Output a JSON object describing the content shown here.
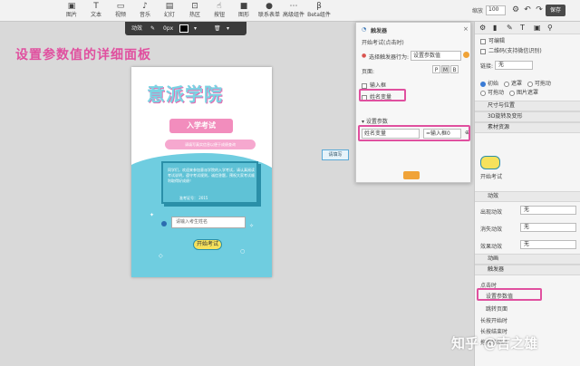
{
  "toolbar": {
    "items": [
      {
        "icon": "image-icon",
        "label": "图片"
      },
      {
        "icon": "text-icon",
        "label": "文本"
      },
      {
        "icon": "video-icon",
        "label": "视频"
      },
      {
        "icon": "music-icon",
        "label": "音乐"
      },
      {
        "icon": "slideshow-icon",
        "label": "幻灯"
      },
      {
        "icon": "hotspot-icon",
        "label": "热区"
      },
      {
        "icon": "button-icon",
        "label": "按钮"
      },
      {
        "icon": "shape-icon",
        "label": "图形"
      },
      {
        "icon": "contact-icon",
        "label": "联系表单"
      },
      {
        "icon": "advanced-icon",
        "label": "高级组件"
      },
      {
        "icon": "beta-icon",
        "label": "Beta组件"
      }
    ],
    "zoom_label": "缩放",
    "zoom_value": "100",
    "save_label": "保存"
  },
  "format_bar": {
    "animation": "动效",
    "stroke": "0px"
  },
  "heading": "设置参数值的详细面板",
  "poster": {
    "title": "意派学院",
    "subtitle": "入学考试",
    "tagline": "请填写真实信息以便于成绩查询",
    "card_text": "同学们，欢迎来参加意派学院的入学考试，请认真阅读考试说明，遵守考试规则，诚信答题，预祝大家考试顺利取得好成绩！",
    "card_code": "准考证号： 2015",
    "input_placeholder": "请输入考生姓名",
    "start_label": "开始考试"
  },
  "hint_bubble": "请填写",
  "trigger_panel": {
    "title": "触发器",
    "event_label": "开始考试(点击时)",
    "action_label": "选择触发器行为:",
    "action_value": "设置参数值",
    "page_label": "页面:",
    "page_options": [
      "P",
      "M",
      "B"
    ],
    "checkbox_input": "输入框",
    "checkbox_var": "姓名变量",
    "param_section": "设置参数",
    "param_var": "姓名变量",
    "param_value": "=输入框0"
  },
  "right_panel": {
    "checkbox_editable": "可编辑",
    "checkbox_qr": "二维码(支持微信识别)",
    "link_label": "链接:",
    "link_value": "无",
    "radios": [
      {
        "label": "初始",
        "on": true
      },
      {
        "label": "遮罩",
        "on": false
      },
      {
        "label": "可拖动",
        "on": false
      },
      {
        "label": "可拖动",
        "on": false
      },
      {
        "label": "图片遮罩",
        "on": false
      }
    ],
    "sec_size": "尺寸与位置",
    "sec_3d": "3D旋转及变形",
    "sec_assets": "素材资源",
    "asset_name": "开始考试",
    "sec_animation": "动效",
    "enter_label": "出现动效",
    "enter_value": "无",
    "exit_label": "消失动效",
    "exit_value": "无",
    "effect_label": "效果动效",
    "effect_value": "无",
    "sec_anim2": "动画",
    "sec_trigger": "触发器",
    "trigger_event": "点击时",
    "trigger_action": "设置参数值",
    "trigger_jump": "跳转页面",
    "trigger_longpress": "长按开始时",
    "trigger_longpress_end": "长按结束时",
    "trigger_drag": "拖拽移动时"
  },
  "watermark": "知乎 @吉之雄",
  "colors": {
    "accent": "#e0509f",
    "poster_blue": "#6fcde0",
    "save_button": "#4a4a4a"
  }
}
